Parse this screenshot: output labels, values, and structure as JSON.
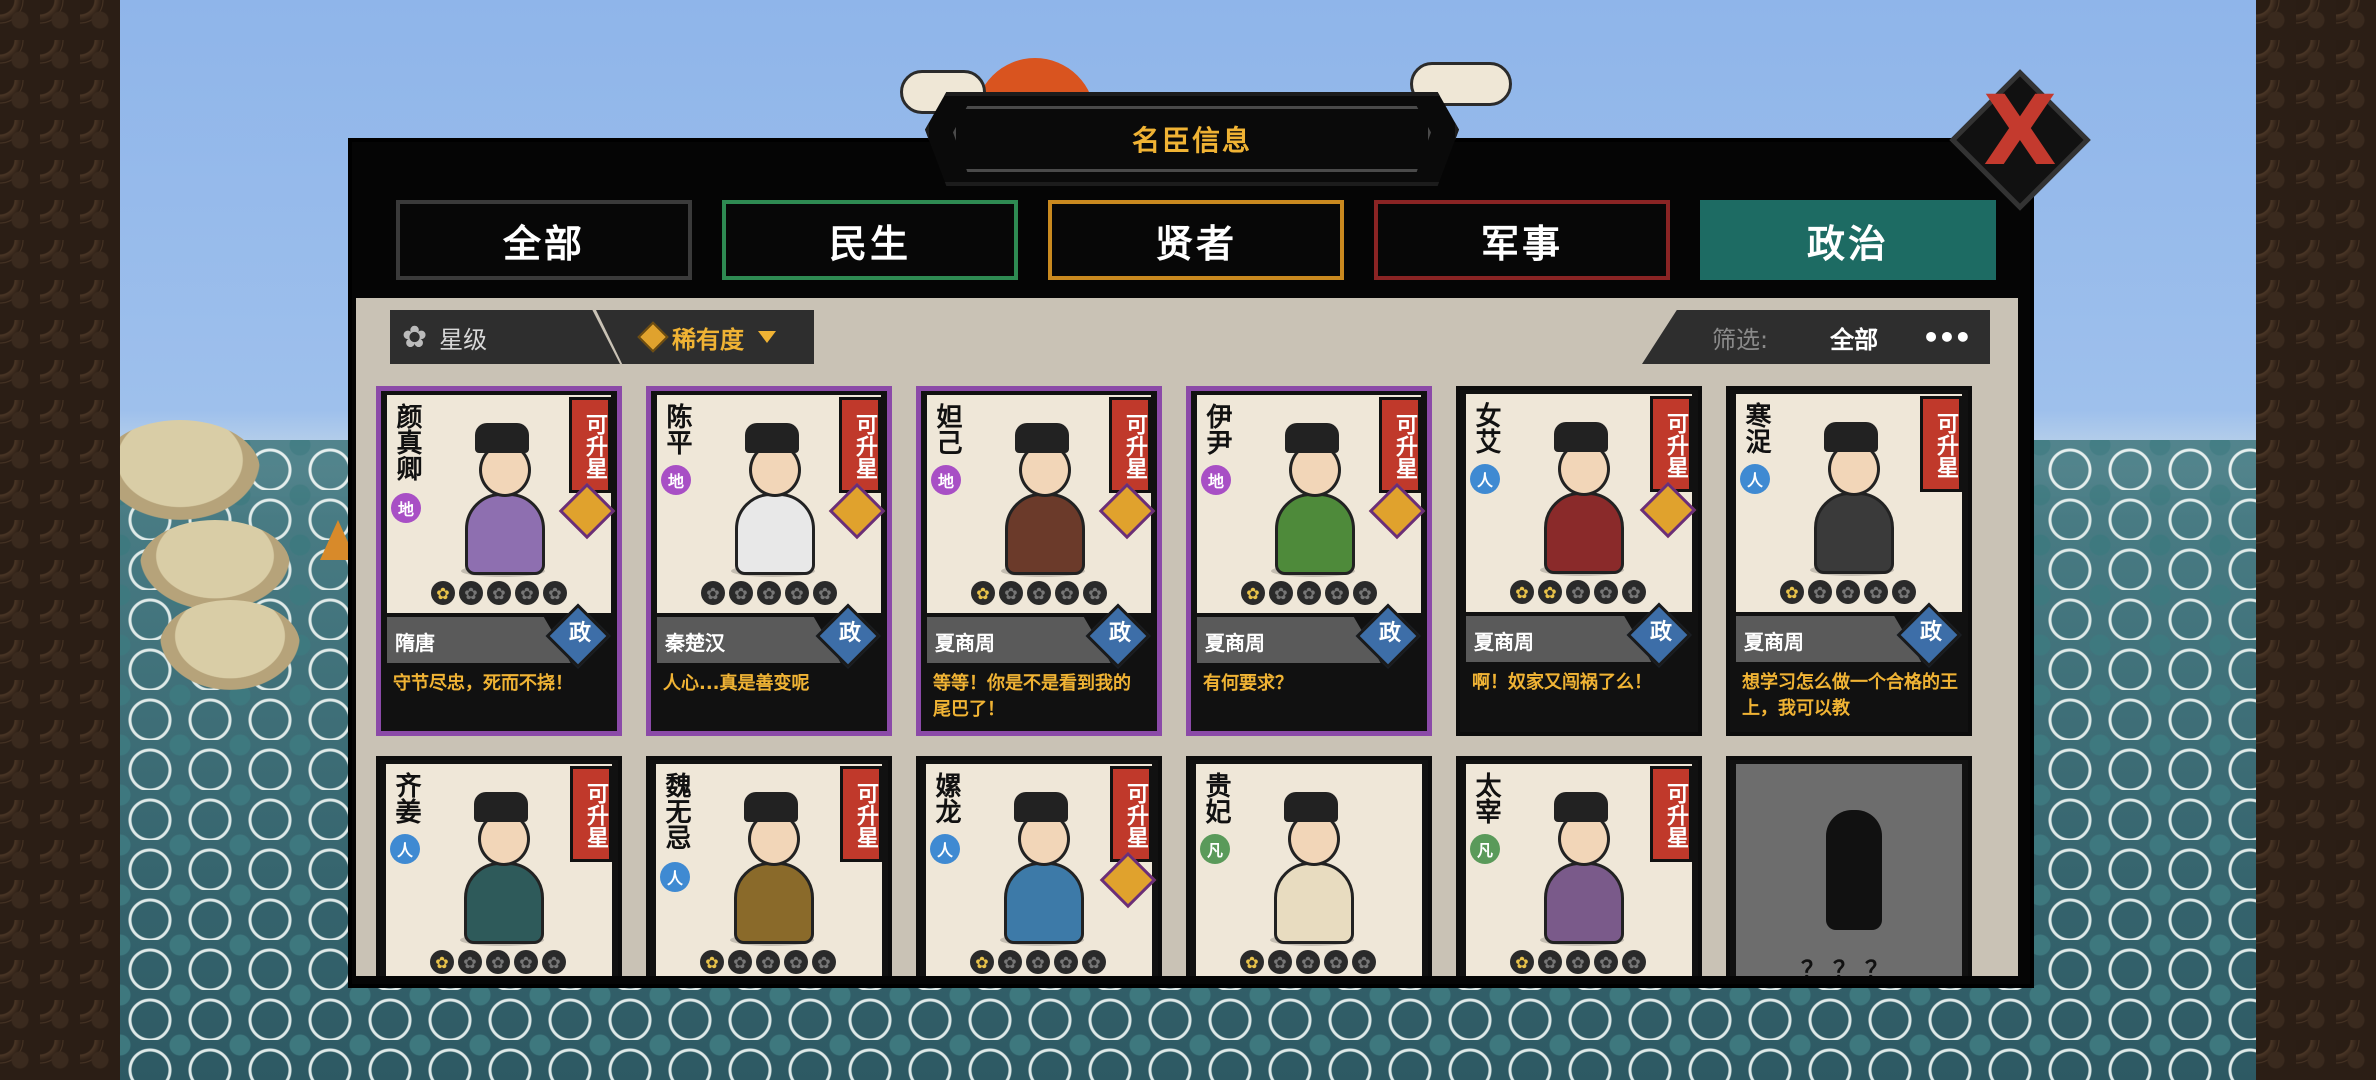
{
  "window": {
    "title": "名臣信息",
    "close_label": "X"
  },
  "tabs": [
    {
      "label": "全部",
      "color": "#3a3a3a",
      "active": false
    },
    {
      "label": "民生",
      "color": "#2e8a52",
      "active": false
    },
    {
      "label": "贤者",
      "color": "#c9891f",
      "active": false
    },
    {
      "label": "军事",
      "color": "#8a2424",
      "active": false
    },
    {
      "label": "政治",
      "color": "#1d6b63",
      "active": true
    }
  ],
  "filters": {
    "star_label": "星级",
    "rarity_label": "稀有度",
    "screen_label": "筛选:",
    "screen_value": "全部",
    "more_label": "•••"
  },
  "cards": [
    {
      "name": "颜真卿",
      "grade": "地",
      "upgrade": "可升星",
      "stars": 1,
      "era": "隋唐",
      "office": "政",
      "quote": "守节尽忠，死而不挠！",
      "border": "#8b4aa8",
      "robe": "#8e6fb0"
    },
    {
      "name": "陈平",
      "grade": "地",
      "upgrade": "可升星",
      "stars": 0,
      "era": "秦楚汉",
      "office": "政",
      "quote": "人心...真是善变呢",
      "border": "#8b4aa8",
      "robe": "#e8e8e8"
    },
    {
      "name": "妲己",
      "grade": "地",
      "upgrade": "可升星",
      "stars": 1,
      "era": "夏商周",
      "office": "政",
      "quote": "等等！你是不是看到我的尾巴了！",
      "border": "#8b4aa8",
      "robe": "#6b3a2a"
    },
    {
      "name": "伊尹",
      "grade": "地",
      "upgrade": "可升星",
      "stars": 1,
      "era": "夏商周",
      "office": "政",
      "quote": "有何要求？",
      "border": "#8b4aa8",
      "robe": "#4e8a3a"
    },
    {
      "name": "女艾",
      "grade": "人",
      "upgrade": "可升星",
      "stars": 2,
      "era": "夏商周",
      "office": "政",
      "quote": "啊！奴家又闯祸了么！",
      "border": "#0c0c0c",
      "robe": "#8a2a2a"
    },
    {
      "name": "寒浞",
      "grade": "人",
      "upgrade": "可升星",
      "stars": 1,
      "era": "夏商周",
      "office": "政",
      "quote": "想学习怎么做一个合格的王上，我可以教",
      "border": "#0c0c0c",
      "robe": "#3a3a3a"
    },
    {
      "name": "齐姜",
      "grade": "人",
      "upgrade": "可升星",
      "stars": 1,
      "era": "",
      "office": "",
      "quote": "",
      "border": "#0c0c0c",
      "robe": "#2e5a5a"
    },
    {
      "name": "魏无忌",
      "grade": "人",
      "upgrade": "可升星",
      "stars": 1,
      "era": "",
      "office": "",
      "quote": "",
      "border": "#0c0c0c",
      "robe": "#8a6a2a"
    },
    {
      "name": "嫘龙",
      "grade": "人",
      "upgrade": "可升星",
      "stars": 1,
      "era": "",
      "office": "",
      "quote": "",
      "border": "#0c0c0c",
      "robe": "#3d7aa8"
    },
    {
      "name": "贵妃",
      "grade": "凡",
      "upgrade": "",
      "stars": 1,
      "era": "",
      "office": "",
      "quote": "",
      "border": "#0c0c0c",
      "robe": "#e8dcc0"
    },
    {
      "name": "太宰",
      "grade": "凡",
      "upgrade": "可升星",
      "stars": 1,
      "era": "",
      "office": "",
      "quote": "",
      "border": "#0c0c0c",
      "robe": "#7a5a8a"
    }
  ],
  "locked_card": {
    "label": "？？？"
  }
}
